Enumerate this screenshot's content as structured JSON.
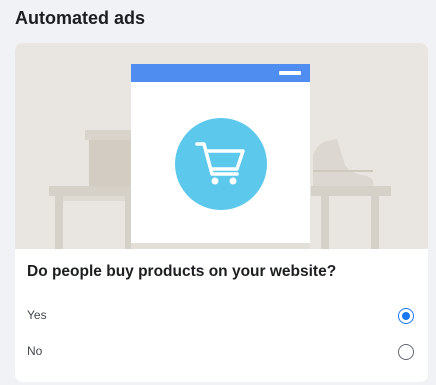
{
  "page": {
    "title": "Automated ads"
  },
  "question": {
    "text": "Do people buy products on your website?"
  },
  "options": [
    {
      "label": "Yes",
      "selected": true
    },
    {
      "label": "No",
      "selected": false
    }
  ],
  "illustration": {
    "icon": "shopping-cart-icon",
    "accent_color": "#4f8ef0",
    "cart_circle_color": "#5bc8ec"
  }
}
